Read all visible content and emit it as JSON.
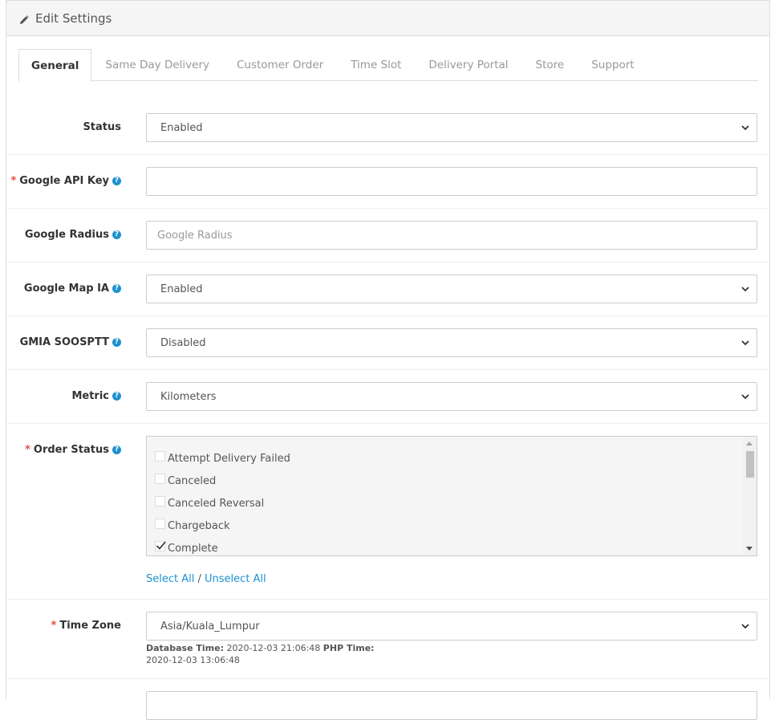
{
  "header": {
    "title": "Edit Settings"
  },
  "tabs": [
    {
      "label": "General"
    },
    {
      "label": "Same Day Delivery"
    },
    {
      "label": "Customer Order"
    },
    {
      "label": "Time Slot"
    },
    {
      "label": "Delivery Portal"
    },
    {
      "label": "Store"
    },
    {
      "label": "Support"
    }
  ],
  "fields": {
    "status": {
      "label": "Status",
      "value": "Enabled"
    },
    "google_api_key": {
      "label": "Google API Key",
      "value": ""
    },
    "google_radius": {
      "label": "Google Radius",
      "placeholder": "Google Radius"
    },
    "google_map_ia": {
      "label": "Google Map IA",
      "value": "Enabled"
    },
    "gmia_soosptt": {
      "label": "GMIA SOOSPTT",
      "value": "Disabled"
    },
    "metric": {
      "label": "Metric",
      "value": "Kilometers"
    },
    "order_status": {
      "label": "Order Status",
      "items": [
        {
          "label": "Attempt Delivery Failed",
          "checked": false
        },
        {
          "label": "Canceled",
          "checked": false
        },
        {
          "label": "Canceled Reversal",
          "checked": false
        },
        {
          "label": "Chargeback",
          "checked": false
        },
        {
          "label": "Complete",
          "checked": true
        }
      ],
      "select_all": "Select All",
      "separator": "/",
      "unselect_all": "Unselect All"
    },
    "time_zone": {
      "label": "Time Zone",
      "value": "Asia/Kuala_Lumpur",
      "db_time_label": "Database Time:",
      "db_time_value": "2020-12-03 21:06:48",
      "php_time_label": "PHP Time:",
      "php_time_value": "2020-12-03 13:06:48"
    }
  },
  "required_marker": "*",
  "help_marker": "?",
  "icons": {
    "header": "pencil-icon",
    "select": "chevron-down-icon",
    "help": "question-circle-icon"
  },
  "colors": {
    "accent": "#1e91cf",
    "required": "#e3503e",
    "border": "#cccccc"
  }
}
